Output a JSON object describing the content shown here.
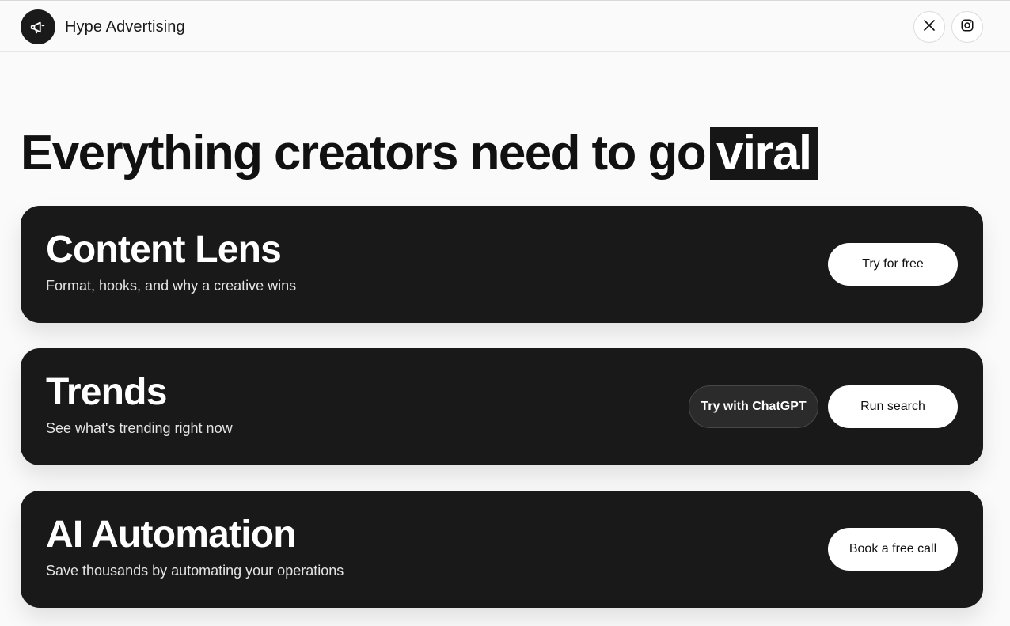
{
  "header": {
    "brand_name": "Hype Advertising",
    "logo_icon": "megaphone-icon",
    "social": [
      {
        "name": "x-icon"
      },
      {
        "name": "instagram-icon"
      }
    ]
  },
  "hero": {
    "headline": "Everything creators need to go",
    "highlight": "viral"
  },
  "cards": [
    {
      "title": "Content Lens",
      "subtitle": "Format, hooks, and why a creative wins",
      "primary_button": "Try for free"
    },
    {
      "title": "Trends",
      "subtitle": "See what's trending right now",
      "secondary_button": "Try with ChatGPT",
      "primary_button": "Run search"
    },
    {
      "title": "AI Automation",
      "subtitle": "Save thousands by automating your operations",
      "primary_button": "Book a free call"
    }
  ],
  "colors": {
    "background": "#fafafa",
    "card": "#1a1919",
    "accent_dark": "#161616"
  }
}
